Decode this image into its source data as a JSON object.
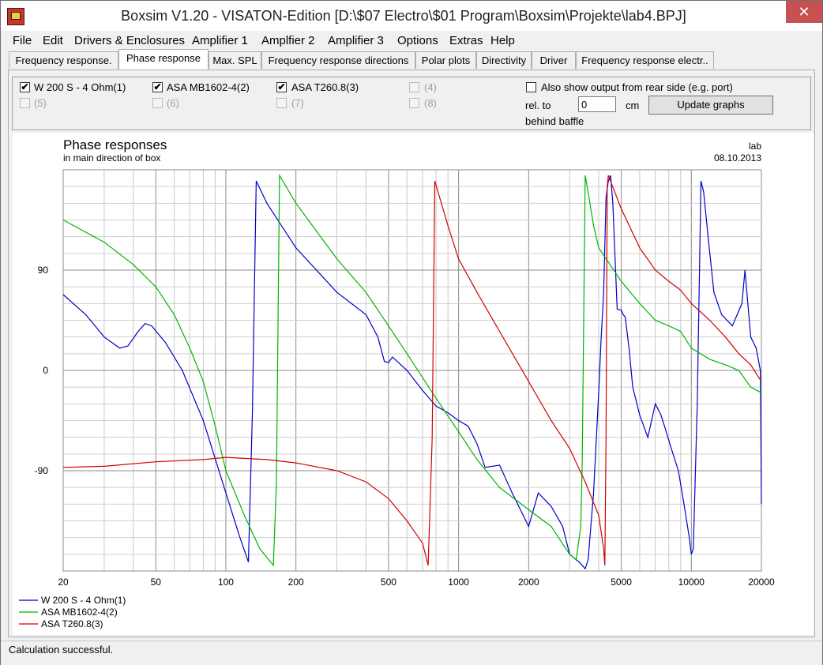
{
  "window": {
    "title": "Boxsim V1.20 - VISATON-Edition [D:\\$07 Electro\\$01 Program\\Boxsim\\Projekte\\lab4.BPJ]",
    "close_glyph": "✕"
  },
  "menu": [
    {
      "label": "File"
    },
    {
      "label": "Edit"
    },
    {
      "label": "Drivers & Enclosures"
    },
    {
      "label": "Amplifier 1"
    },
    {
      "label": "Amplfier 2"
    },
    {
      "label": "Amplifier 3"
    },
    {
      "label": "Options"
    },
    {
      "label": "Extras"
    },
    {
      "label": "Help"
    }
  ],
  "tabs": [
    {
      "label": "Frequency response."
    },
    {
      "label": "Phase response",
      "active": true
    },
    {
      "label": "Max. SPL"
    },
    {
      "label": "Frequency response directions"
    },
    {
      "label": "Polar plots"
    },
    {
      "label": "Directivity"
    },
    {
      "label": "Driver"
    },
    {
      "label": "Frequency response electr.."
    }
  ],
  "drivers": [
    {
      "label": "W 200 S - 4 Ohm(1)",
      "checked": true,
      "enabled": true
    },
    {
      "label": "ASA MB1602-4(2)",
      "checked": true,
      "enabled": true
    },
    {
      "label": "ASA T260.8(3)",
      "checked": true,
      "enabled": true
    },
    {
      "label": "(4)",
      "checked": false,
      "enabled": false
    },
    {
      "label": "(5)",
      "checked": false,
      "enabled": false
    },
    {
      "label": "(6)",
      "checked": false,
      "enabled": false
    },
    {
      "label": "(7)",
      "checked": false,
      "enabled": false
    },
    {
      "label": "(8)",
      "checked": false,
      "enabled": false
    }
  ],
  "rear_output": {
    "label": "Also show output from rear side (e.g. port)",
    "checked": false,
    "rel_to_label": "rel. to",
    "value": "0",
    "unit": "cm",
    "behind_label": "behind baffle",
    "update_button": "Update graphs"
  },
  "status": "Calculation successful.",
  "chart_data": {
    "type": "line",
    "title": "Phase responses",
    "subtitle": "in main direction of box",
    "top_right_label": "lab",
    "date": "08.10.2013",
    "x_scale": "log",
    "xlim": [
      20,
      20000
    ],
    "ylim": [
      -180,
      180
    ],
    "x_ticks": [
      {
        "value": 20,
        "label": "20"
      },
      {
        "value": 50,
        "label": "50"
      },
      {
        "value": 100,
        "label": "100"
      },
      {
        "value": 200,
        "label": "200"
      },
      {
        "value": 500,
        "label": "500"
      },
      {
        "value": 1000,
        "label": "1000"
      },
      {
        "value": 2000,
        "label": "2000"
      },
      {
        "value": 5000,
        "label": "5000"
      },
      {
        "value": 10000,
        "label": "10000"
      },
      {
        "value": 20000,
        "label": "20000"
      }
    ],
    "y_ticks": [
      {
        "value": 90,
        "label": "90"
      },
      {
        "value": 0,
        "label": "0"
      },
      {
        "value": -90,
        "label": "-90"
      }
    ],
    "grid": true,
    "legend_position": "bottom-left",
    "series": [
      {
        "name": "W 200 S - 4 Ohm(1)",
        "color": "#0000c8",
        "points": [
          [
            20,
            68
          ],
          [
            25,
            50
          ],
          [
            30,
            30
          ],
          [
            35,
            20
          ],
          [
            38,
            22
          ],
          [
            42,
            35
          ],
          [
            45,
            42
          ],
          [
            48,
            40
          ],
          [
            55,
            25
          ],
          [
            65,
            0
          ],
          [
            80,
            -45
          ],
          [
            100,
            -110
          ],
          [
            115,
            -150
          ],
          [
            125,
            -172
          ],
          [
            130,
            -40
          ],
          [
            135,
            170
          ],
          [
            150,
            150
          ],
          [
            200,
            110
          ],
          [
            300,
            70
          ],
          [
            400,
            50
          ],
          [
            450,
            30
          ],
          [
            480,
            8
          ],
          [
            500,
            7
          ],
          [
            520,
            12
          ],
          [
            600,
            0
          ],
          [
            700,
            -18
          ],
          [
            800,
            -32
          ],
          [
            900,
            -38
          ],
          [
            1000,
            -45
          ],
          [
            1100,
            -50
          ],
          [
            1200,
            -66
          ],
          [
            1300,
            -87
          ],
          [
            1500,
            -85
          ],
          [
            1700,
            -110
          ],
          [
            2000,
            -140
          ],
          [
            2200,
            -110
          ],
          [
            2500,
            -122
          ],
          [
            2800,
            -140
          ],
          [
            3000,
            -165
          ],
          [
            3300,
            -172
          ],
          [
            3500,
            -178
          ],
          [
            3600,
            -170
          ],
          [
            3800,
            -110
          ],
          [
            4000,
            -20
          ],
          [
            4100,
            30
          ],
          [
            4200,
            70
          ],
          [
            4300,
            155
          ],
          [
            4400,
            170
          ],
          [
            4500,
            175
          ],
          [
            4600,
            150
          ],
          [
            4800,
            55
          ],
          [
            5000,
            54
          ],
          [
            5100,
            50
          ],
          [
            5200,
            48
          ],
          [
            5400,
            20
          ],
          [
            5600,
            -15
          ],
          [
            6000,
            -40
          ],
          [
            6500,
            -60
          ],
          [
            7000,
            -30
          ],
          [
            7400,
            -40
          ],
          [
            7800,
            -55
          ],
          [
            8200,
            -70
          ],
          [
            8800,
            -90
          ],
          [
            9300,
            -120
          ],
          [
            9800,
            -150
          ],
          [
            10000,
            -165
          ],
          [
            10200,
            -160
          ],
          [
            10600,
            -30
          ],
          [
            11000,
            170
          ],
          [
            11300,
            160
          ],
          [
            11800,
            120
          ],
          [
            12500,
            70
          ],
          [
            13500,
            50
          ],
          [
            15000,
            40
          ],
          [
            16500,
            60
          ],
          [
            17000,
            90
          ],
          [
            18000,
            30
          ],
          [
            19000,
            20
          ],
          [
            19800,
            0
          ],
          [
            20000,
            -120
          ]
        ]
      },
      {
        "name": "ASA MB1602-4(2)",
        "color": "#00b400",
        "points": [
          [
            20,
            135
          ],
          [
            30,
            115
          ],
          [
            40,
            95
          ],
          [
            50,
            75
          ],
          [
            60,
            50
          ],
          [
            70,
            20
          ],
          [
            80,
            -10
          ],
          [
            90,
            -50
          ],
          [
            100,
            -90
          ],
          [
            120,
            -130
          ],
          [
            140,
            -160
          ],
          [
            160,
            -175
          ],
          [
            165,
            -100
          ],
          [
            170,
            175
          ],
          [
            200,
            150
          ],
          [
            300,
            100
          ],
          [
            400,
            70
          ],
          [
            500,
            40
          ],
          [
            600,
            15
          ],
          [
            800,
            -25
          ],
          [
            1000,
            -55
          ],
          [
            1200,
            -80
          ],
          [
            1500,
            -105
          ],
          [
            2000,
            -125
          ],
          [
            2500,
            -140
          ],
          [
            3000,
            -165
          ],
          [
            3200,
            -170
          ],
          [
            3350,
            -140
          ],
          [
            3400,
            -80
          ],
          [
            3500,
            175
          ],
          [
            3600,
            160
          ],
          [
            3800,
            130
          ],
          [
            4000,
            110
          ],
          [
            5000,
            80
          ],
          [
            6000,
            60
          ],
          [
            7000,
            45
          ],
          [
            8000,
            40
          ],
          [
            9000,
            35
          ],
          [
            10000,
            20
          ],
          [
            12000,
            10
          ],
          [
            14000,
            5
          ],
          [
            16000,
            0
          ],
          [
            18000,
            -15
          ],
          [
            20000,
            -20
          ]
        ]
      },
      {
        "name": "ASA T260.8(3)",
        "color": "#d20000",
        "points": [
          [
            20,
            -87
          ],
          [
            30,
            -86
          ],
          [
            50,
            -82
          ],
          [
            80,
            -80
          ],
          [
            100,
            -78
          ],
          [
            150,
            -80
          ],
          [
            200,
            -83
          ],
          [
            300,
            -90
          ],
          [
            400,
            -100
          ],
          [
            500,
            -115
          ],
          [
            600,
            -135
          ],
          [
            700,
            -155
          ],
          [
            740,
            -175
          ],
          [
            770,
            -60
          ],
          [
            790,
            170
          ],
          [
            900,
            130
          ],
          [
            1000,
            100
          ],
          [
            1200,
            70
          ],
          [
            1500,
            35
          ],
          [
            2000,
            -10
          ],
          [
            2500,
            -45
          ],
          [
            3000,
            -70
          ],
          [
            3500,
            -100
          ],
          [
            4000,
            -130
          ],
          [
            4200,
            -160
          ],
          [
            4250,
            -175
          ],
          [
            4300,
            -60
          ],
          [
            4350,
            165
          ],
          [
            4400,
            175
          ],
          [
            5000,
            145
          ],
          [
            6000,
            110
          ],
          [
            7000,
            90
          ],
          [
            8000,
            80
          ],
          [
            9000,
            72
          ],
          [
            10000,
            60
          ],
          [
            12000,
            45
          ],
          [
            14000,
            30
          ],
          [
            16000,
            15
          ],
          [
            18000,
            5
          ],
          [
            20000,
            -10
          ]
        ]
      }
    ]
  }
}
